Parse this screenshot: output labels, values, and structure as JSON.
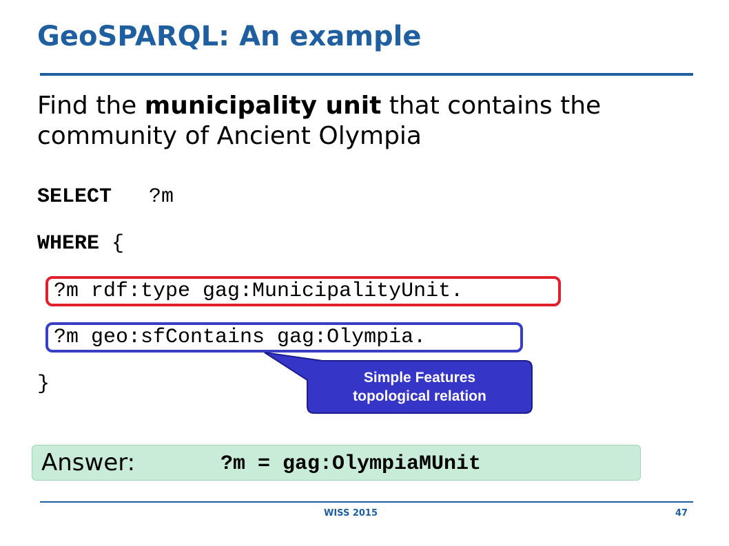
{
  "slide": {
    "title": "GeoSPARQL: An example",
    "question": {
      "before": "Find the ",
      "bold": "municipality unit",
      "after": " that contains the community of Ancient Olympia"
    },
    "query": {
      "select_keyword": "SELECT",
      "select_var": "?m",
      "where_keyword": "WHERE",
      "open_brace": "{",
      "triple1": "?m rdf:type gag:MunicipalityUnit.",
      "triple2": "?m geo:sfContains gag:Olympia.",
      "close_brace": "}"
    },
    "callout": {
      "line1": "Simple Features",
      "line2": "topological relation"
    },
    "answer": {
      "label": "Answer:",
      "value": "?m = gag:OlympiaMUnit"
    },
    "footer": {
      "left": "WISS 2015",
      "page_number": "47"
    },
    "colors": {
      "accent": "#1f5fa0",
      "red_box": "#e0202a",
      "blue_box": "#3a3ec4",
      "callout_fill": "#3535c8",
      "answer_bg": "#c8ecd8"
    }
  }
}
